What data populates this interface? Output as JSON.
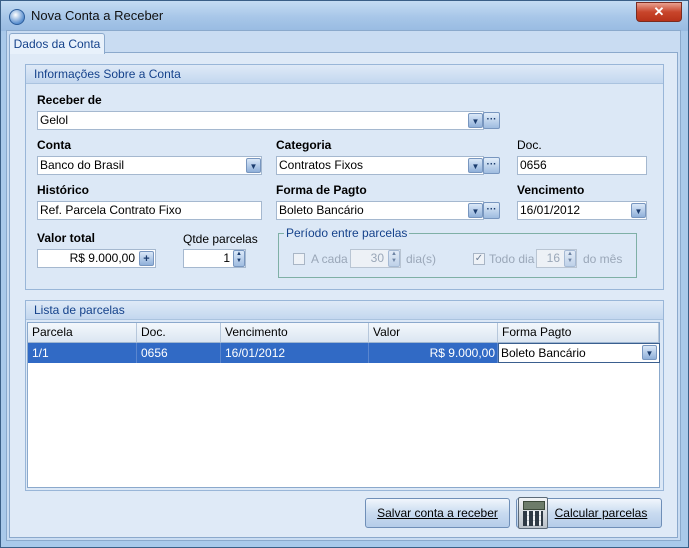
{
  "window": {
    "title": "Nova Conta a Receber",
    "close_glyph": "✕"
  },
  "tab": {
    "label": "Dados da Conta"
  },
  "info_group": {
    "header": "Informações Sobre a Conta",
    "receber_de": {
      "label": "Receber de",
      "value": "Gelol"
    },
    "conta": {
      "label": "Conta",
      "value": "Banco do Brasil"
    },
    "categoria": {
      "label": "Categoria",
      "value": "Contratos Fixos"
    },
    "doc": {
      "label": "Doc.",
      "value": "0656"
    },
    "historico": {
      "label": "Histórico",
      "value": "Ref. Parcela Contrato Fixo"
    },
    "forma_pagto": {
      "label": "Forma de Pagto",
      "value": "Boleto Bancário"
    },
    "vencimento": {
      "label": "Vencimento",
      "value": "16/01/2012"
    },
    "valor_total": {
      "label": "Valor total",
      "value": "R$ 9.000,00"
    },
    "qtde_parcelas": {
      "label": "Qtde parcelas",
      "value": "1"
    },
    "periodo": {
      "legend": "Período entre parcelas",
      "a_cada_label": "A cada",
      "a_cada_value": "30",
      "a_cada_unit": "dia(s)",
      "todo_dia_label": "Todo dia",
      "todo_dia_value": "16",
      "todo_dia_unit": "do mês",
      "a_cada_checked": false,
      "todo_dia_checked": true
    }
  },
  "parcelas_group": {
    "header": "Lista de parcelas",
    "columns": [
      "Parcela",
      "Doc.",
      "Vencimento",
      "Valor",
      "Forma Pagto"
    ],
    "rows": [
      {
        "parcela": "1/1",
        "doc": "0656",
        "vencimento": "16/01/2012",
        "valor": "R$ 9.000,00",
        "forma_pagto": "Boleto Bancário"
      }
    ]
  },
  "buttons": {
    "salvar": "Salvar conta a receber",
    "calcular": "Calcular parcelas"
  },
  "icons": {
    "dropdown": "▼",
    "ellipsis": "···",
    "plus": "+",
    "spin_up": "▲",
    "spin_down": "▼",
    "check": "✓"
  },
  "colors": {
    "selection": "#316ac5",
    "header_text": "#15428b"
  }
}
